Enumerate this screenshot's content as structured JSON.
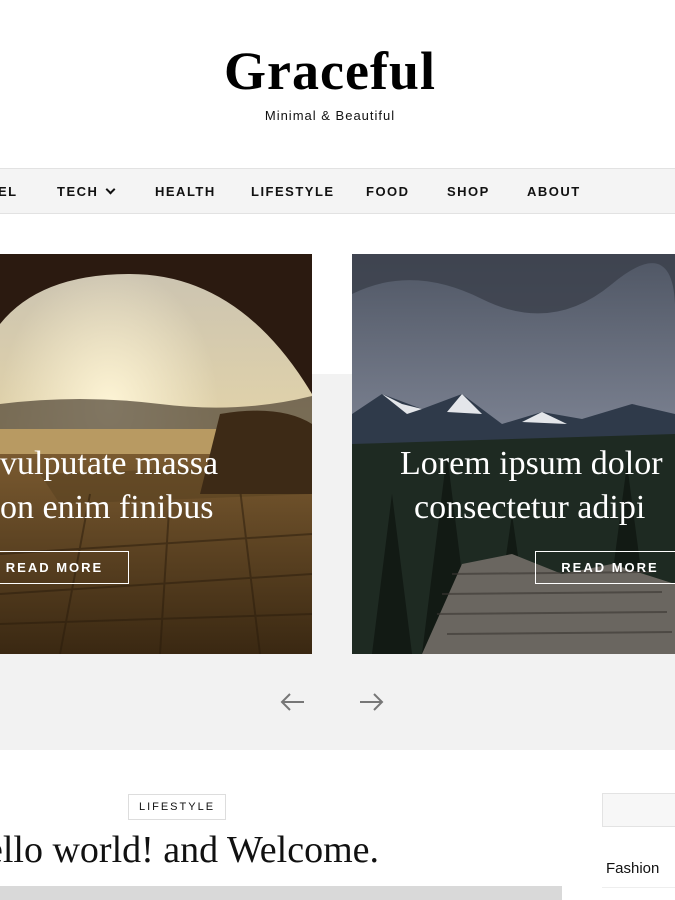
{
  "site": {
    "title": "Graceful",
    "tagline": "Minimal & Beautiful"
  },
  "nav": {
    "items": [
      {
        "label": "EL"
      },
      {
        "label": "TECH"
      },
      {
        "label": "HEALTH"
      },
      {
        "label": "LIFESTYLE"
      },
      {
        "label": "FOOD"
      },
      {
        "label": "SHOP"
      },
      {
        "label": "ABOUT"
      }
    ]
  },
  "slider": {
    "slides": [
      {
        "title_line1": "vulputate massa",
        "title_line2": "on enim finibus",
        "button": "READ MORE"
      },
      {
        "title_line1": "Lorem ipsum dolor",
        "title_line2": "consectetur adipi",
        "button": "READ MORE"
      }
    ],
    "prev_icon": "arrow-left-icon",
    "next_icon": "arrow-right-icon"
  },
  "post": {
    "category": "LIFESTYLE",
    "title": "ello world! and Welcome."
  },
  "sidebar": {
    "category_item": "Fashion"
  }
}
